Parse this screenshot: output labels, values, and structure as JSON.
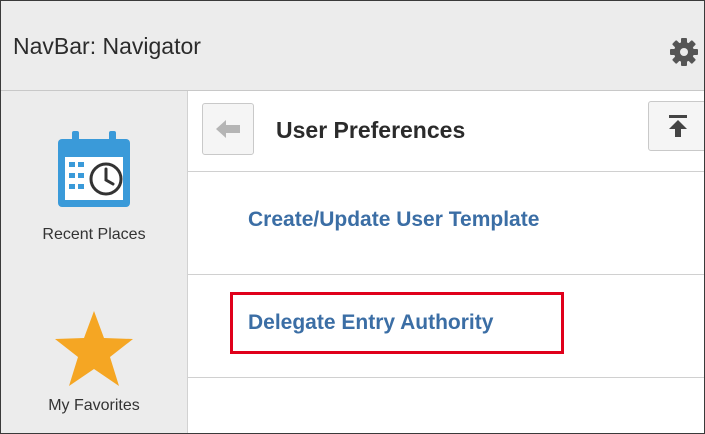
{
  "navbar": {
    "title": "NavBar: Navigator",
    "settings_icon": "gear-icon"
  },
  "sidebar": {
    "tiles": [
      {
        "label": "Recent Places",
        "icon": "calendar-clock-icon"
      },
      {
        "label": "My Favorites",
        "icon": "star-icon"
      }
    ]
  },
  "panel": {
    "title": "User Preferences",
    "back_icon": "back-arrow-icon",
    "top_icon": "scroll-to-top-icon",
    "items": [
      {
        "label": "Create/Update User Template"
      },
      {
        "label": "Delegate Entry Authority",
        "highlighted": true
      }
    ]
  },
  "colors": {
    "link": "#3b6ea5",
    "highlight_border": "#e0001b",
    "calendar": "#3a9ad9",
    "star": "#f5a623",
    "header_bg": "#ececec"
  }
}
